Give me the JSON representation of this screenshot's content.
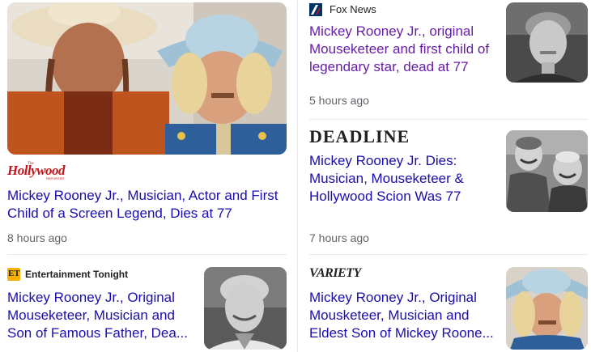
{
  "cards": [
    {
      "source": "The Hollywood Reporter",
      "source_logo_text": "Hollywood",
      "source_logo_small": "The",
      "source_logo_sub": "REPORTER",
      "headline": "Mickey Rooney Jr., Musician, Actor and First Child of a Screen Legend, Dies at 77",
      "time": "8 hours ago",
      "image": "two-cowboys-photo"
    },
    {
      "source": "Fox News",
      "headline": "Mickey Rooney Jr., original Mouseketeer and first child of legendary star, dead at 77",
      "time": "5 hours ago",
      "image": "young-man-bw-photo"
    },
    {
      "source": "DEADLINE",
      "headline": "Mickey Rooney Jr. Dies: Musician, Mouseketeer & Hollywood Scion Was 77",
      "time": "7 hours ago",
      "image": "two-men-laughing-bw-photo"
    },
    {
      "source": "Entertainment Tonight",
      "source_badge": "ET",
      "headline": "Mickey Rooney Jr., Original Mouseketeer, Musician and Son of Famous Father, Dea...",
      "image": "young-man-bw-photo-2"
    },
    {
      "source": "VARIETY",
      "headline": "Mickey Rooney Jr., Original Mousketeer, Musician and Eldest Son of Mickey Roone...",
      "image": "cowboy-hat-man-photo"
    }
  ],
  "colors": {
    "link": "#1a0dab",
    "visited": "#681da8",
    "meta": "#5f6368",
    "divider": "#e8eaed",
    "hollywood_red": "#c4161c"
  }
}
